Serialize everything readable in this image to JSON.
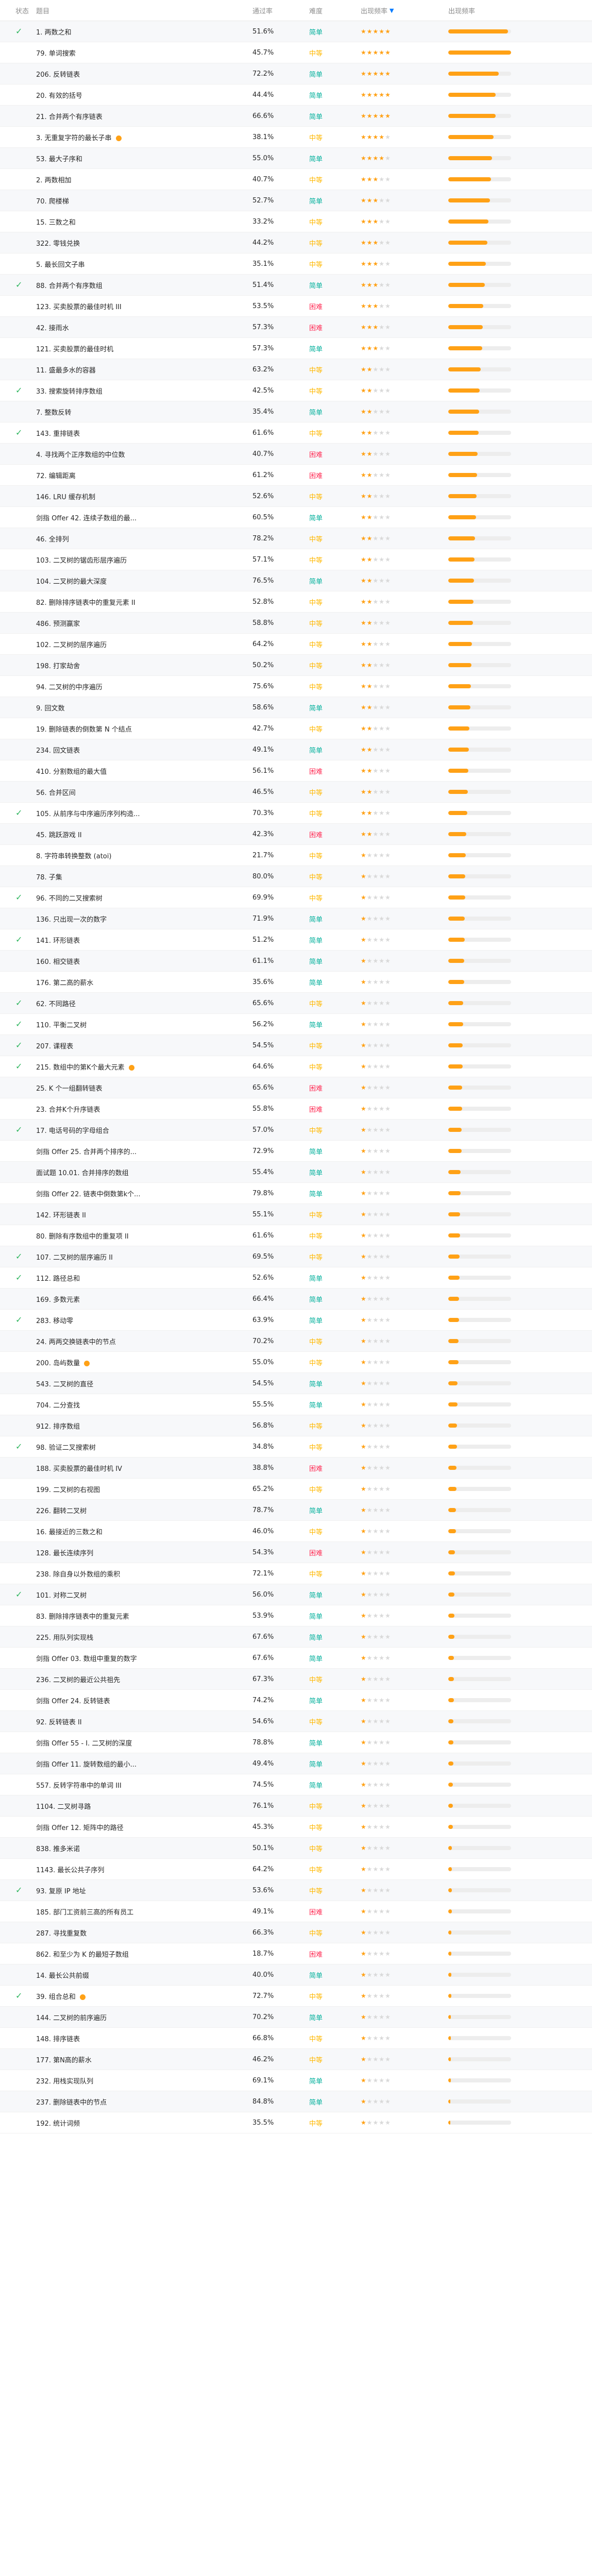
{
  "header": {
    "status": "状态",
    "title": "题目",
    "rate": "通过率",
    "difficulty": "难度",
    "frequency": "出现频率",
    "sort_icon": "sort-descending-icon",
    "frequency2": "出现频率"
  },
  "colors": {
    "easy": "#00af9b",
    "medium": "#ffb800",
    "hard": "#ff2d55",
    "accent": "#ffa116",
    "check": "#2db55d"
  },
  "rows": [
    {
      "done": true,
      "title": "1. 两数之和",
      "rate": "51.6%",
      "diff": "简单",
      "level": "easy",
      "stars": 5,
      "freq": 0.95,
      "medal": false
    },
    {
      "done": false,
      "title": "79. 单词搜索",
      "rate": "45.7%",
      "diff": "中等",
      "level": "medium",
      "stars": 5,
      "freq": 1.0,
      "medal": false
    },
    {
      "done": false,
      "title": "206. 反转链表",
      "rate": "72.2%",
      "diff": "简单",
      "level": "easy",
      "stars": 5,
      "freq": 0.8,
      "medal": false
    },
    {
      "done": false,
      "title": "20. 有效的括号",
      "rate": "44.4%",
      "diff": "简单",
      "level": "easy",
      "stars": 5,
      "freq": 0.75,
      "medal": false
    },
    {
      "done": false,
      "title": "21. 合并两个有序链表",
      "rate": "66.6%",
      "diff": "简单",
      "level": "easy",
      "stars": 5,
      "freq": 0.75,
      "medal": false
    },
    {
      "done": false,
      "title": "3. 无重复字符的最长子串",
      "rate": "38.1%",
      "diff": "中等",
      "level": "medium",
      "stars": 4,
      "freq": 0.72,
      "medal": true
    },
    {
      "done": false,
      "title": "53. 最大子序和",
      "rate": "55.0%",
      "diff": "简单",
      "level": "easy",
      "stars": 4,
      "freq": 0.7,
      "medal": false
    },
    {
      "done": false,
      "title": "2. 两数相加",
      "rate": "40.7%",
      "diff": "中等",
      "level": "medium",
      "stars": 3,
      "freq": 0.68,
      "medal": false
    },
    {
      "done": false,
      "title": "70. 爬楼梯",
      "rate": "52.7%",
      "diff": "简单",
      "level": "easy",
      "stars": 3,
      "freq": 0.66,
      "medal": false
    },
    {
      "done": false,
      "title": "15. 三数之和",
      "rate": "33.2%",
      "diff": "中等",
      "level": "medium",
      "stars": 3,
      "freq": 0.64,
      "medal": false
    },
    {
      "done": false,
      "title": "322. 零钱兑换",
      "rate": "44.2%",
      "diff": "中等",
      "level": "medium",
      "stars": 3,
      "freq": 0.62,
      "medal": false
    },
    {
      "done": false,
      "title": "5. 最长回文子串",
      "rate": "35.1%",
      "diff": "中等",
      "level": "medium",
      "stars": 3,
      "freq": 0.6,
      "medal": false
    },
    {
      "done": true,
      "title": "88. 合并两个有序数组",
      "rate": "51.4%",
      "diff": "简单",
      "level": "easy",
      "stars": 3,
      "freq": 0.58,
      "medal": false
    },
    {
      "done": false,
      "title": "123. 买卖股票的最佳时机 III",
      "rate": "53.5%",
      "diff": "困难",
      "level": "hard",
      "stars": 3,
      "freq": 0.56,
      "medal": false
    },
    {
      "done": false,
      "title": "42. 接雨水",
      "rate": "57.3%",
      "diff": "困难",
      "level": "hard",
      "stars": 3,
      "freq": 0.55,
      "medal": false
    },
    {
      "done": false,
      "title": "121. 买卖股票的最佳时机",
      "rate": "57.3%",
      "diff": "简单",
      "level": "easy",
      "stars": 3,
      "freq": 0.54,
      "medal": false
    },
    {
      "done": false,
      "title": "11. 盛最多水的容器",
      "rate": "63.2%",
      "diff": "中等",
      "level": "medium",
      "stars": 2,
      "freq": 0.52,
      "medal": false
    },
    {
      "done": true,
      "title": "33. 搜索旋转排序数组",
      "rate": "42.5%",
      "diff": "中等",
      "level": "medium",
      "stars": 2,
      "freq": 0.5,
      "medal": false
    },
    {
      "done": false,
      "title": "7. 整数反转",
      "rate": "35.4%",
      "diff": "简单",
      "level": "easy",
      "stars": 2,
      "freq": 0.49,
      "medal": false
    },
    {
      "done": true,
      "title": "143. 重排链表",
      "rate": "61.6%",
      "diff": "中等",
      "level": "medium",
      "stars": 2,
      "freq": 0.48,
      "medal": false
    },
    {
      "done": false,
      "title": "4. 寻找两个正序数组的中位数",
      "rate": "40.7%",
      "diff": "困难",
      "level": "hard",
      "stars": 2,
      "freq": 0.47,
      "medal": false
    },
    {
      "done": false,
      "title": "72. 编辑距离",
      "rate": "61.2%",
      "diff": "困难",
      "level": "hard",
      "stars": 2,
      "freq": 0.46,
      "medal": false
    },
    {
      "done": false,
      "title": "146. LRU 缓存机制",
      "rate": "52.6%",
      "diff": "中等",
      "level": "medium",
      "stars": 2,
      "freq": 0.45,
      "medal": false
    },
    {
      "done": false,
      "title": "剑指 Offer 42. 连续子数组的最...",
      "rate": "60.5%",
      "diff": "简单",
      "level": "easy",
      "stars": 2,
      "freq": 0.44,
      "medal": false
    },
    {
      "done": false,
      "title": "46. 全排列",
      "rate": "78.2%",
      "diff": "中等",
      "level": "medium",
      "stars": 2,
      "freq": 0.43,
      "medal": false
    },
    {
      "done": false,
      "title": "103. 二叉树的锯齿形层序遍历",
      "rate": "57.1%",
      "diff": "中等",
      "level": "medium",
      "stars": 2,
      "freq": 0.42,
      "medal": false
    },
    {
      "done": false,
      "title": "104. 二叉树的最大深度",
      "rate": "76.5%",
      "diff": "简单",
      "level": "easy",
      "stars": 2,
      "freq": 0.41,
      "medal": false
    },
    {
      "done": false,
      "title": "82. 删除排序链表中的重复元素 II",
      "rate": "52.8%",
      "diff": "中等",
      "level": "medium",
      "stars": 2,
      "freq": 0.4,
      "medal": false
    },
    {
      "done": false,
      "title": "486. 预测赢家",
      "rate": "58.8%",
      "diff": "中等",
      "level": "medium",
      "stars": 2,
      "freq": 0.39,
      "medal": false
    },
    {
      "done": false,
      "title": "102. 二叉树的层序遍历",
      "rate": "64.2%",
      "diff": "中等",
      "level": "medium",
      "stars": 2,
      "freq": 0.38,
      "medal": false
    },
    {
      "done": false,
      "title": "198. 打家劫舍",
      "rate": "50.2%",
      "diff": "中等",
      "level": "medium",
      "stars": 2,
      "freq": 0.37,
      "medal": false
    },
    {
      "done": false,
      "title": "94. 二叉树的中序遍历",
      "rate": "75.6%",
      "diff": "中等",
      "level": "medium",
      "stars": 2,
      "freq": 0.36,
      "medal": false
    },
    {
      "done": false,
      "title": "9. 回文数",
      "rate": "58.6%",
      "diff": "简单",
      "level": "easy",
      "stars": 2,
      "freq": 0.35,
      "medal": false
    },
    {
      "done": false,
      "title": "19. 删除链表的倒数第 N 个结点",
      "rate": "42.7%",
      "diff": "中等",
      "level": "medium",
      "stars": 2,
      "freq": 0.34,
      "medal": false
    },
    {
      "done": false,
      "title": "234. 回文链表",
      "rate": "49.1%",
      "diff": "简单",
      "level": "easy",
      "stars": 2,
      "freq": 0.33,
      "medal": false
    },
    {
      "done": false,
      "title": "410. 分割数组的最大值",
      "rate": "56.1%",
      "diff": "困难",
      "level": "hard",
      "stars": 2,
      "freq": 0.32,
      "medal": false
    },
    {
      "done": false,
      "title": "56. 合并区间",
      "rate": "46.5%",
      "diff": "中等",
      "level": "medium",
      "stars": 2,
      "freq": 0.31,
      "medal": false
    },
    {
      "done": true,
      "title": "105. 从前序与中序遍历序列构造...",
      "rate": "70.3%",
      "diff": "中等",
      "level": "medium",
      "stars": 2,
      "freq": 0.3,
      "medal": false
    },
    {
      "done": false,
      "title": "45. 跳跃游戏 II",
      "rate": "42.3%",
      "diff": "困难",
      "level": "hard",
      "stars": 2,
      "freq": 0.29,
      "medal": false
    },
    {
      "done": false,
      "title": "8. 字符串转换整数 (atoi)",
      "rate": "21.7%",
      "diff": "中等",
      "level": "medium",
      "stars": 1,
      "freq": 0.28,
      "medal": false
    },
    {
      "done": false,
      "title": "78. 子集",
      "rate": "80.0%",
      "diff": "中等",
      "level": "medium",
      "stars": 1,
      "freq": 0.27,
      "medal": false
    },
    {
      "done": true,
      "title": "96. 不同的二叉搜索树",
      "rate": "69.9%",
      "diff": "中等",
      "level": "medium",
      "stars": 1,
      "freq": 0.27,
      "medal": false
    },
    {
      "done": false,
      "title": "136. 只出现一次的数字",
      "rate": "71.9%",
      "diff": "简单",
      "level": "easy",
      "stars": 1,
      "freq": 0.26,
      "medal": false
    },
    {
      "done": true,
      "title": "141. 环形链表",
      "rate": "51.2%",
      "diff": "简单",
      "level": "easy",
      "stars": 1,
      "freq": 0.26,
      "medal": false
    },
    {
      "done": false,
      "title": "160. 相交链表",
      "rate": "61.1%",
      "diff": "简单",
      "level": "easy",
      "stars": 1,
      "freq": 0.25,
      "medal": false
    },
    {
      "done": false,
      "title": "176. 第二高的薪水",
      "rate": "35.6%",
      "diff": "简单",
      "level": "easy",
      "stars": 1,
      "freq": 0.25,
      "medal": false
    },
    {
      "done": true,
      "title": "62. 不同路径",
      "rate": "65.6%",
      "diff": "中等",
      "level": "medium",
      "stars": 1,
      "freq": 0.24,
      "medal": false
    },
    {
      "done": true,
      "title": "110. 平衡二叉树",
      "rate": "56.2%",
      "diff": "简单",
      "level": "easy",
      "stars": 1,
      "freq": 0.24,
      "medal": false
    },
    {
      "done": true,
      "title": "207. 课程表",
      "rate": "54.5%",
      "diff": "中等",
      "level": "medium",
      "stars": 1,
      "freq": 0.23,
      "medal": false
    },
    {
      "done": true,
      "title": "215. 数组中的第K个最大元素",
      "rate": "64.6%",
      "diff": "中等",
      "level": "medium",
      "stars": 1,
      "freq": 0.23,
      "medal": true
    },
    {
      "done": false,
      "title": "25. K 个一组翻转链表",
      "rate": "65.6%",
      "diff": "困难",
      "level": "hard",
      "stars": 1,
      "freq": 0.22,
      "medal": false
    },
    {
      "done": false,
      "title": "23. 合并K个升序链表",
      "rate": "55.8%",
      "diff": "困难",
      "level": "hard",
      "stars": 1,
      "freq": 0.22,
      "medal": false
    },
    {
      "done": true,
      "title": "17. 电话号码的字母组合",
      "rate": "57.0%",
      "diff": "中等",
      "level": "medium",
      "stars": 1,
      "freq": 0.21,
      "medal": false
    },
    {
      "done": false,
      "title": "剑指 Offer 25. 合并两个排序的...",
      "rate": "72.9%",
      "diff": "简单",
      "level": "easy",
      "stars": 1,
      "freq": 0.21,
      "medal": false
    },
    {
      "done": false,
      "title": "面试题 10.01. 合并排序的数组",
      "rate": "55.4%",
      "diff": "简单",
      "level": "easy",
      "stars": 1,
      "freq": 0.2,
      "medal": false
    },
    {
      "done": false,
      "title": "剑指 Offer 22. 链表中倒数第k个...",
      "rate": "79.8%",
      "diff": "简单",
      "level": "easy",
      "stars": 1,
      "freq": 0.2,
      "medal": false
    },
    {
      "done": false,
      "title": "142. 环形链表 II",
      "rate": "55.1%",
      "diff": "中等",
      "level": "medium",
      "stars": 1,
      "freq": 0.19,
      "medal": false
    },
    {
      "done": false,
      "title": "80. 删除有序数组中的重复项 II",
      "rate": "61.6%",
      "diff": "中等",
      "level": "medium",
      "stars": 1,
      "freq": 0.19,
      "medal": false
    },
    {
      "done": true,
      "title": "107. 二叉树的层序遍历 II",
      "rate": "69.5%",
      "diff": "中等",
      "level": "medium",
      "stars": 1,
      "freq": 0.18,
      "medal": false
    },
    {
      "done": true,
      "title": "112. 路径总和",
      "rate": "52.6%",
      "diff": "简单",
      "level": "easy",
      "stars": 1,
      "freq": 0.18,
      "medal": false
    },
    {
      "done": false,
      "title": "169. 多数元素",
      "rate": "66.4%",
      "diff": "简单",
      "level": "easy",
      "stars": 1,
      "freq": 0.17,
      "medal": false
    },
    {
      "done": true,
      "title": "283. 移动零",
      "rate": "63.9%",
      "diff": "简单",
      "level": "easy",
      "stars": 1,
      "freq": 0.17,
      "medal": false
    },
    {
      "done": false,
      "title": "24. 两两交换链表中的节点",
      "rate": "70.2%",
      "diff": "中等",
      "level": "medium",
      "stars": 1,
      "freq": 0.16,
      "medal": false
    },
    {
      "done": false,
      "title": "200. 岛屿数量",
      "rate": "55.0%",
      "diff": "中等",
      "level": "medium",
      "stars": 1,
      "freq": 0.16,
      "medal": true
    },
    {
      "done": false,
      "title": "543. 二叉树的直径",
      "rate": "54.5%",
      "diff": "简单",
      "level": "easy",
      "stars": 1,
      "freq": 0.15,
      "medal": false
    },
    {
      "done": false,
      "title": "704. 二分查找",
      "rate": "55.5%",
      "diff": "简单",
      "level": "easy",
      "stars": 1,
      "freq": 0.15,
      "medal": false
    },
    {
      "done": false,
      "title": "912. 排序数组",
      "rate": "56.8%",
      "diff": "中等",
      "level": "medium",
      "stars": 1,
      "freq": 0.14,
      "medal": false
    },
    {
      "done": true,
      "title": "98. 验证二叉搜索树",
      "rate": "34.8%",
      "diff": "中等",
      "level": "medium",
      "stars": 1,
      "freq": 0.14,
      "medal": false
    },
    {
      "done": false,
      "title": "188. 买卖股票的最佳时机 IV",
      "rate": "38.8%",
      "diff": "困难",
      "level": "hard",
      "stars": 1,
      "freq": 0.13,
      "medal": false
    },
    {
      "done": false,
      "title": "199. 二叉树的右视图",
      "rate": "65.2%",
      "diff": "中等",
      "level": "medium",
      "stars": 1,
      "freq": 0.13,
      "medal": false
    },
    {
      "done": false,
      "title": "226. 翻转二叉树",
      "rate": "78.7%",
      "diff": "简单",
      "level": "easy",
      "stars": 1,
      "freq": 0.12,
      "medal": false
    },
    {
      "done": false,
      "title": "16. 最接近的三数之和",
      "rate": "46.0%",
      "diff": "中等",
      "level": "medium",
      "stars": 1,
      "freq": 0.12,
      "medal": false
    },
    {
      "done": false,
      "title": "128. 最长连续序列",
      "rate": "54.3%",
      "diff": "困难",
      "level": "hard",
      "stars": 1,
      "freq": 0.11,
      "medal": false
    },
    {
      "done": false,
      "title": "238. 除自身以外数组的乘积",
      "rate": "72.1%",
      "diff": "中等",
      "level": "medium",
      "stars": 1,
      "freq": 0.11,
      "medal": false
    },
    {
      "done": true,
      "title": "101. 对称二叉树",
      "rate": "56.0%",
      "diff": "简单",
      "level": "easy",
      "stars": 1,
      "freq": 0.1,
      "medal": false
    },
    {
      "done": false,
      "title": "83. 删除排序链表中的重复元素",
      "rate": "53.9%",
      "diff": "简单",
      "level": "easy",
      "stars": 1,
      "freq": 0.1,
      "medal": false
    },
    {
      "done": false,
      "title": "225. 用队列实现栈",
      "rate": "67.6%",
      "diff": "简单",
      "level": "easy",
      "stars": 1,
      "freq": 0.1,
      "medal": false
    },
    {
      "done": false,
      "title": "剑指 Offer 03. 数组中重复的数字",
      "rate": "67.6%",
      "diff": "简单",
      "level": "easy",
      "stars": 1,
      "freq": 0.09,
      "medal": false
    },
    {
      "done": false,
      "title": "236. 二叉树的最近公共祖先",
      "rate": "67.3%",
      "diff": "中等",
      "level": "medium",
      "stars": 1,
      "freq": 0.09,
      "medal": false
    },
    {
      "done": false,
      "title": "剑指 Offer 24. 反转链表",
      "rate": "74.2%",
      "diff": "简单",
      "level": "easy",
      "stars": 1,
      "freq": 0.09,
      "medal": false
    },
    {
      "done": false,
      "title": "92. 反转链表 II",
      "rate": "54.6%",
      "diff": "中等",
      "level": "medium",
      "stars": 1,
      "freq": 0.08,
      "medal": false
    },
    {
      "done": false,
      "title": "剑指 Offer 55 - I. 二叉树的深度",
      "rate": "78.8%",
      "diff": "简单",
      "level": "easy",
      "stars": 1,
      "freq": 0.08,
      "medal": false
    },
    {
      "done": false,
      "title": "剑指 Offer 11. 旋转数组的最小...",
      "rate": "49.4%",
      "diff": "简单",
      "level": "easy",
      "stars": 1,
      "freq": 0.08,
      "medal": false
    },
    {
      "done": false,
      "title": "557. 反转字符串中的单词 III",
      "rate": "74.5%",
      "diff": "简单",
      "level": "easy",
      "stars": 1,
      "freq": 0.07,
      "medal": false
    },
    {
      "done": false,
      "title": "1104. 二叉树寻路",
      "rate": "76.1%",
      "diff": "中等",
      "level": "medium",
      "stars": 1,
      "freq": 0.07,
      "medal": false
    },
    {
      "done": false,
      "title": "剑指 Offer 12. 矩阵中的路径",
      "rate": "45.3%",
      "diff": "中等",
      "level": "medium",
      "stars": 1,
      "freq": 0.07,
      "medal": false
    },
    {
      "done": false,
      "title": "838. 推多米诺",
      "rate": "50.1%",
      "diff": "中等",
      "level": "medium",
      "stars": 1,
      "freq": 0.06,
      "medal": false
    },
    {
      "done": false,
      "title": "1143. 最长公共子序列",
      "rate": "64.2%",
      "diff": "中等",
      "level": "medium",
      "stars": 1,
      "freq": 0.06,
      "medal": false
    },
    {
      "done": true,
      "title": "93. 复原 IP 地址",
      "rate": "53.6%",
      "diff": "中等",
      "level": "medium",
      "stars": 1,
      "freq": 0.06,
      "medal": false
    },
    {
      "done": false,
      "title": "185. 部门工资前三高的所有员工",
      "rate": "49.1%",
      "diff": "困难",
      "level": "hard",
      "stars": 1,
      "freq": 0.06,
      "medal": false
    },
    {
      "done": false,
      "title": "287. 寻找重复数",
      "rate": "66.3%",
      "diff": "中等",
      "level": "medium",
      "stars": 1,
      "freq": 0.05,
      "medal": false
    },
    {
      "done": false,
      "title": "862. 和至少为 K 的最短子数组",
      "rate": "18.7%",
      "diff": "困难",
      "level": "hard",
      "stars": 1,
      "freq": 0.05,
      "medal": false
    },
    {
      "done": false,
      "title": "14. 最长公共前缀",
      "rate": "40.0%",
      "diff": "简单",
      "level": "easy",
      "stars": 1,
      "freq": 0.05,
      "medal": false
    },
    {
      "done": true,
      "title": "39. 组合总和",
      "rate": "72.7%",
      "diff": "中等",
      "level": "medium",
      "stars": 1,
      "freq": 0.05,
      "medal": true
    },
    {
      "done": false,
      "title": "144. 二叉树的前序遍历",
      "rate": "70.2%",
      "diff": "简单",
      "level": "easy",
      "stars": 1,
      "freq": 0.04,
      "medal": false
    },
    {
      "done": false,
      "title": "148. 排序链表",
      "rate": "66.8%",
      "diff": "中等",
      "level": "medium",
      "stars": 1,
      "freq": 0.04,
      "medal": false
    },
    {
      "done": false,
      "title": "177. 第N高的薪水",
      "rate": "46.2%",
      "diff": "中等",
      "level": "medium",
      "stars": 1,
      "freq": 0.04,
      "medal": false
    },
    {
      "done": false,
      "title": "232. 用栈实现队列",
      "rate": "69.1%",
      "diff": "简单",
      "level": "easy",
      "stars": 1,
      "freq": 0.04,
      "medal": false
    },
    {
      "done": false,
      "title": "237. 删除链表中的节点",
      "rate": "84.8%",
      "diff": "简单",
      "level": "easy",
      "stars": 1,
      "freq": 0.03,
      "medal": false
    },
    {
      "done": false,
      "title": "192. 统计词频",
      "rate": "35.5%",
      "diff": "中等",
      "level": "medium",
      "stars": 1,
      "freq": 0.03,
      "medal": false
    }
  ]
}
